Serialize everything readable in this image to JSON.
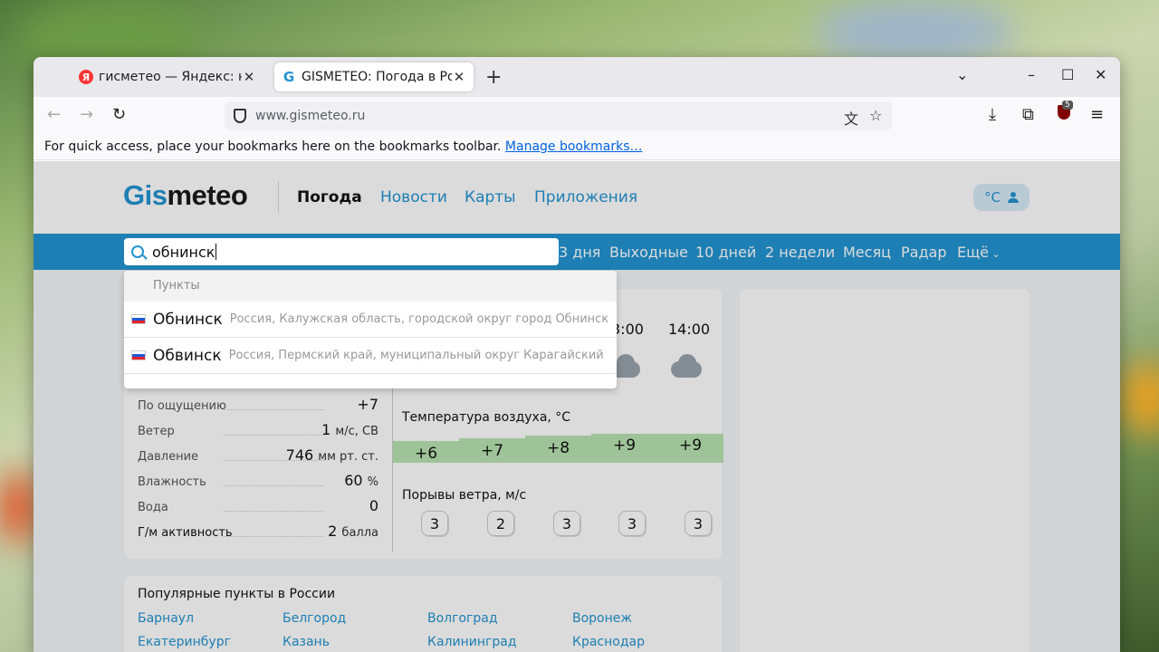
{
  "browser": {
    "tabs": [
      {
        "title": "гисметео — Яндекс: на",
        "favicon": "yandex-icon"
      },
      {
        "title": "GISMETEO: Погода в Рос",
        "favicon": "gismeteo-icon"
      }
    ],
    "url": "www.gismeteo.ru",
    "bookmarks_bar": {
      "text": "For quick access, place your bookmarks here on the bookmarks toolbar.",
      "link": "Manage bookmarks…"
    },
    "extension_badge": "5"
  },
  "site": {
    "logo_part1": "Gis",
    "logo_part2": "meteo",
    "nav": [
      "Погода",
      "Новости",
      "Карты",
      "Приложения"
    ],
    "unit": "°C",
    "periods": [
      "3 дня",
      "Выходные",
      "10 дней",
      "2 недели",
      "Месяц",
      "Радар",
      "Ещё"
    ],
    "search": {
      "value": "обнинск"
    },
    "dropdown": {
      "header": "Пункты",
      "items": [
        {
          "name": "Обнинск",
          "desc": "Россия, Калужская область, городской округ город Обнинск"
        },
        {
          "name": "Обвинск",
          "desc": "Россия, Пермский край, муниципальный округ Карагайский"
        }
      ]
    },
    "params": [
      {
        "label": "По ощущению",
        "value": "+7",
        "unit": ""
      },
      {
        "label": "Ветер",
        "value": "1",
        "unit": "м/с, СВ"
      },
      {
        "label": "Давление",
        "value": "746",
        "unit": "мм рт. ст."
      },
      {
        "label": "Влажность",
        "value": "60",
        "unit": "%"
      },
      {
        "label": "Вода",
        "value": "0",
        "unit": ""
      },
      {
        "label": "Г/м активность",
        "value": "2",
        "unit": "балла"
      }
    ],
    "times": [
      "3:00",
      "14:00"
    ],
    "temp_label": "Температура воздуха, °C",
    "temps": [
      "+6",
      "+7",
      "+8",
      "+9",
      "+9"
    ],
    "gust_label": "Порывы ветра, м/с",
    "gusts": [
      "3",
      "2",
      "3",
      "3",
      "3"
    ],
    "popular": {
      "title": "Популярные пункты в России",
      "cities": [
        "Барнаул",
        "Белгород",
        "Волгоград",
        "Воронеж",
        "Екатеринбург",
        "Казань",
        "Калининград",
        "Краснодар"
      ]
    }
  },
  "colors": {
    "brand": "#2294d2",
    "temp_band": "#b9e4b1"
  }
}
